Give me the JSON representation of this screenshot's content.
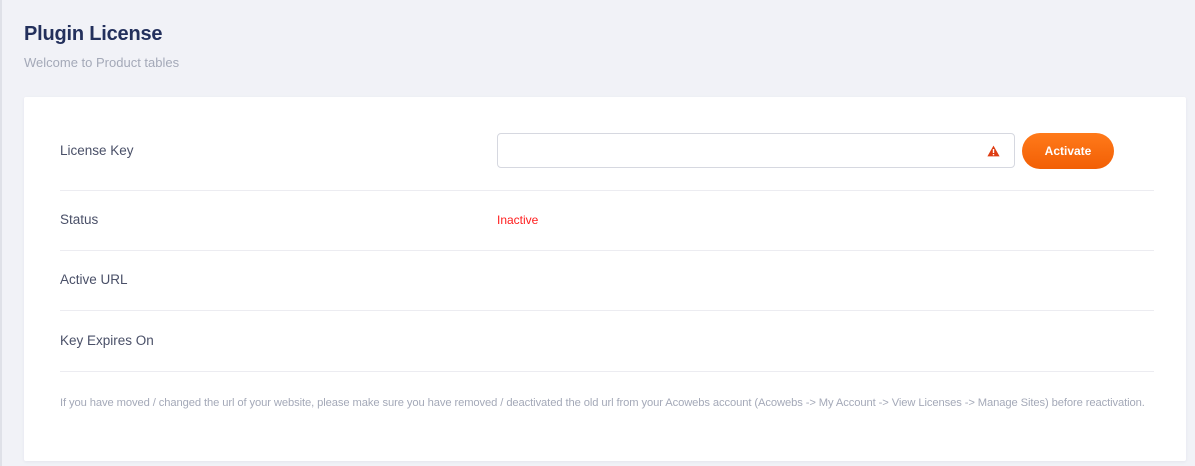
{
  "header": {
    "title": "Plugin License",
    "subtitle": "Welcome to Product tables"
  },
  "license": {
    "key_label": "License Key",
    "input_value": "",
    "input_placeholder": "",
    "warning_icon": "warning-triangle-icon",
    "activate_label": "Activate",
    "status_label": "Status",
    "status_value": "Inactive",
    "active_url_label": "Active URL",
    "active_url_value": "",
    "expires_label": "Key Expires On",
    "expires_value": ""
  },
  "note": "If you have moved / changed the url of your website, please make sure you have removed / deactivated the old url from your Acowebs account (Acowebs -> My Account -> View Licenses -> Manage Sites) before reactivation.",
  "colors": {
    "title": "#23305c",
    "accent": "#f46a0f",
    "status_inactive": "#ff1c1c",
    "background": "#f1f2f7"
  }
}
